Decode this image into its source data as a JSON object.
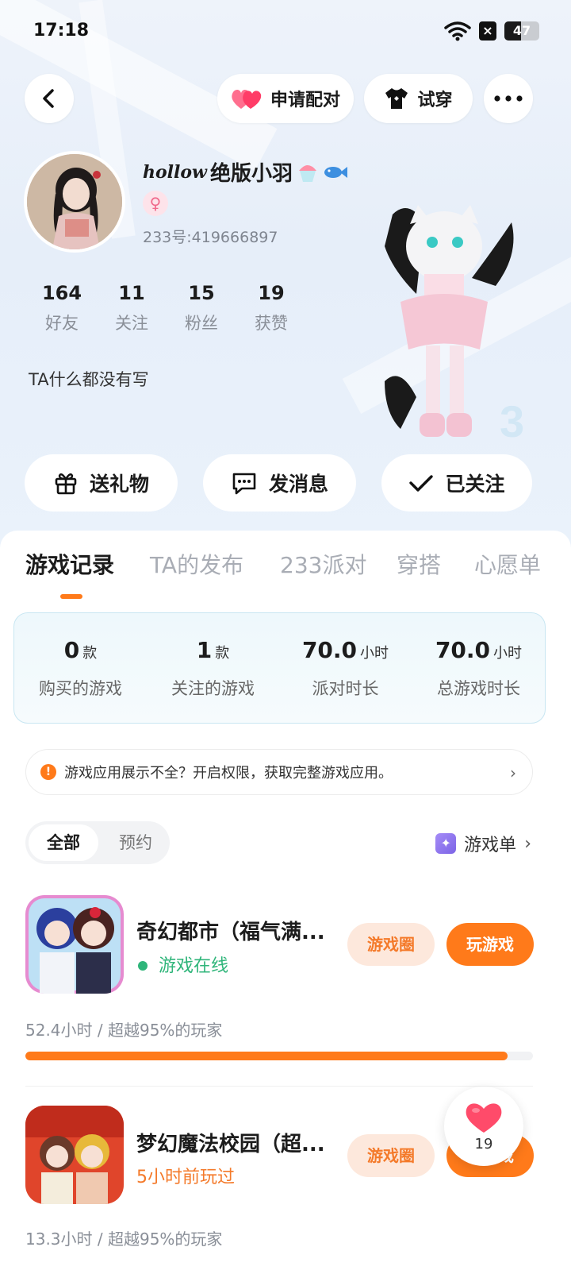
{
  "status_bar": {
    "time": "17:18",
    "battery": "47",
    "battery_level": 47
  },
  "header": {
    "pair_label": "申请配对",
    "tryon_label": "试穿"
  },
  "profile": {
    "name_script": "hollow",
    "name_main": "绝版小羽",
    "gender_symbol": "♀",
    "uid": "233号:419666897",
    "stats": [
      {
        "num": "164",
        "label": "好友"
      },
      {
        "num": "11",
        "label": "关注"
      },
      {
        "num": "15",
        "label": "粉丝"
      },
      {
        "num": "19",
        "label": "获赞"
      }
    ],
    "bio": "TA什么都没有写"
  },
  "actions": {
    "gift": "送礼物",
    "message": "发消息",
    "follow": "已关注"
  },
  "tabs": [
    {
      "label": "游戏记录",
      "active": true
    },
    {
      "label": "TA的发布",
      "active": false
    },
    {
      "label": "233派对",
      "active": false
    },
    {
      "label": "穿搭",
      "active": false
    },
    {
      "label": "心愿单",
      "active": false
    }
  ],
  "summary": [
    {
      "value": "0",
      "unit": "款",
      "label": "购买的游戏"
    },
    {
      "value": "1",
      "unit": "款",
      "label": "关注的游戏"
    },
    {
      "value": "70.0",
      "unit": "小时",
      "label": "派对时长"
    },
    {
      "value": "70.0",
      "unit": "小时",
      "label": "总游戏时长"
    }
  ],
  "notice": {
    "icon_text": "!",
    "text": "游戏应用展示不全？开启权限，获取完整游戏应用。"
  },
  "filter": {
    "all": "全部",
    "reserve": "预约",
    "game_list": "游戏单"
  },
  "games": [
    {
      "title": "奇幻都市（福气满...",
      "status": "游戏在线",
      "status_color": "#2fb57a",
      "circle_label": "游戏圈",
      "play_label": "玩游戏",
      "playtime": "52.4小时 / 超越95%的玩家",
      "progress": 0.95
    },
    {
      "title": "梦幻魔法校园（超...",
      "status": "5小时前玩过",
      "status_color": "#f47a2a",
      "circle_label": "游戏圈",
      "play_label": "玩游戏",
      "playtime": "13.3小时 / 超越95%的玩家",
      "progress": 0.95
    }
  ],
  "like_float": {
    "count": "19"
  },
  "colors": {
    "accent": "#ff7a1a",
    "online": "#2fb57a",
    "heart": "#ff4b6a"
  }
}
